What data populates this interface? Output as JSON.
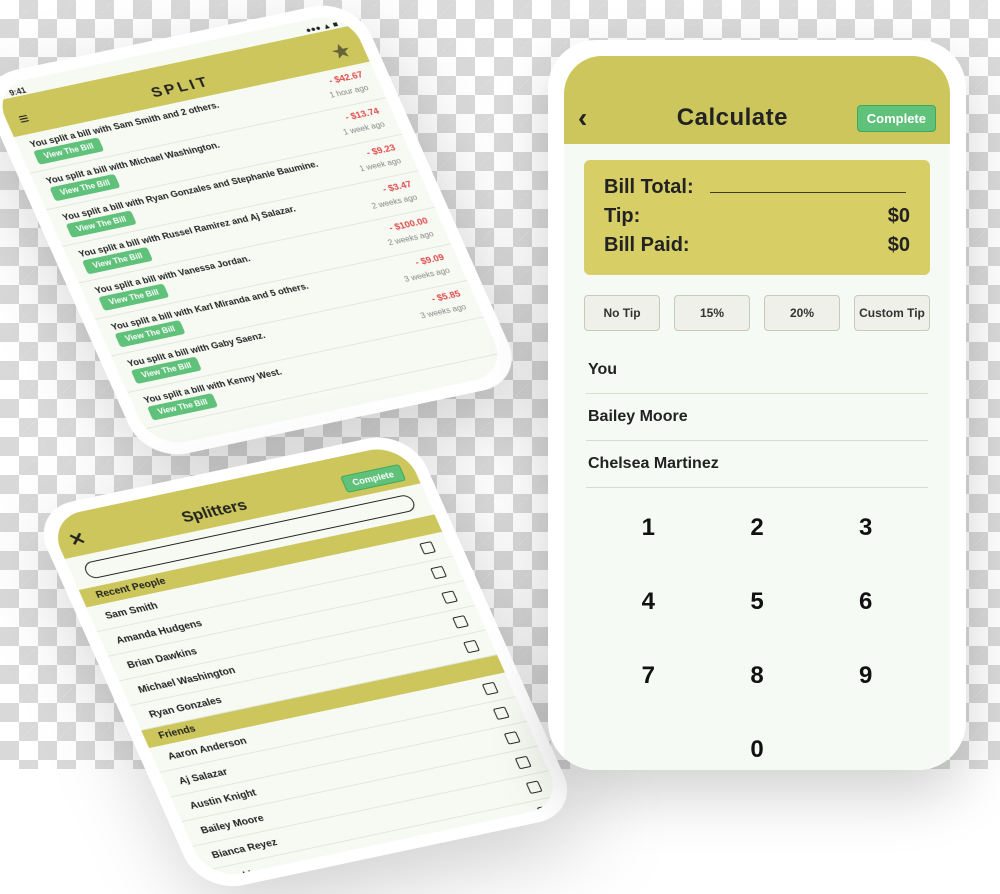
{
  "colors": {
    "accent": "#ccc65c",
    "action": "#5fc17a",
    "danger": "#e04a4a"
  },
  "calculate": {
    "title": "Calculate",
    "back_glyph": "‹",
    "complete_label": "Complete",
    "card": {
      "bill_total_label": "Bill Total:",
      "tip_label": "Tip:",
      "tip_value": "$0",
      "bill_paid_label": "Bill Paid:",
      "bill_paid_value": "$0"
    },
    "tip_options": {
      "none": "No Tip",
      "fifteen": "15%",
      "twenty": "20%",
      "custom": "Custom Tip"
    },
    "people": {
      "p0": "You",
      "p1": "Bailey Moore",
      "p2": "Chelsea Martinez"
    },
    "keys": {
      "k1": "1",
      "k2": "2",
      "k3": "3",
      "k4": "4",
      "k5": "5",
      "k6": "6",
      "k7": "7",
      "k8": "8",
      "k9": "9",
      "k0": "0"
    }
  },
  "split_history": {
    "status_time": "9:41",
    "title": "SPLIT",
    "view_label": "View The Bill",
    "items": [
      {
        "text": "You split a bill with Sam Smith and 2 others.",
        "amount": "- $42.67",
        "when": "1 hour ago"
      },
      {
        "text": "You split a bill with Michael Washington.",
        "amount": "- $13.74",
        "when": "1 week ago"
      },
      {
        "text": "You split a bill with Ryan Gonzales and Stephanie Baumine.",
        "amount": "- $9.23",
        "when": "1 week ago"
      },
      {
        "text": "You split a bill with Russel Ramirez and Aj Salazar.",
        "amount": "- $3.47",
        "when": "2 weeks ago"
      },
      {
        "text": "You split a bill with Vanessa Jordan.",
        "amount": "- $100.00",
        "when": "2 weeks ago"
      },
      {
        "text": "You split a bill with Karl Miranda and 5 others.",
        "amount": "- $9.09",
        "when": "3 weeks ago"
      },
      {
        "text": "You split a bill with Gaby Saenz.",
        "amount": "- $5.85",
        "when": "3 weeks ago"
      },
      {
        "text": "You split a bill with Kenny West.",
        "amount": "",
        "when": ""
      }
    ]
  },
  "splitters": {
    "title": "Splitters",
    "close_glyph": "✕",
    "done_label": "Complete",
    "search_placeholder": "",
    "sections": {
      "recent": {
        "header": "Recent People",
        "people": [
          "Sam Smith",
          "Amanda Hudgens",
          "Brian Dawkins",
          "Michael Washington",
          "Ryan Gonzales"
        ]
      },
      "friends": {
        "header": "Friends",
        "people": [
          "Aaron Anderson",
          "Aj Salazar",
          "Austin Knight",
          "Bailey Moore",
          "Bianca Reyez",
          "Dawkins"
        ]
      }
    }
  }
}
